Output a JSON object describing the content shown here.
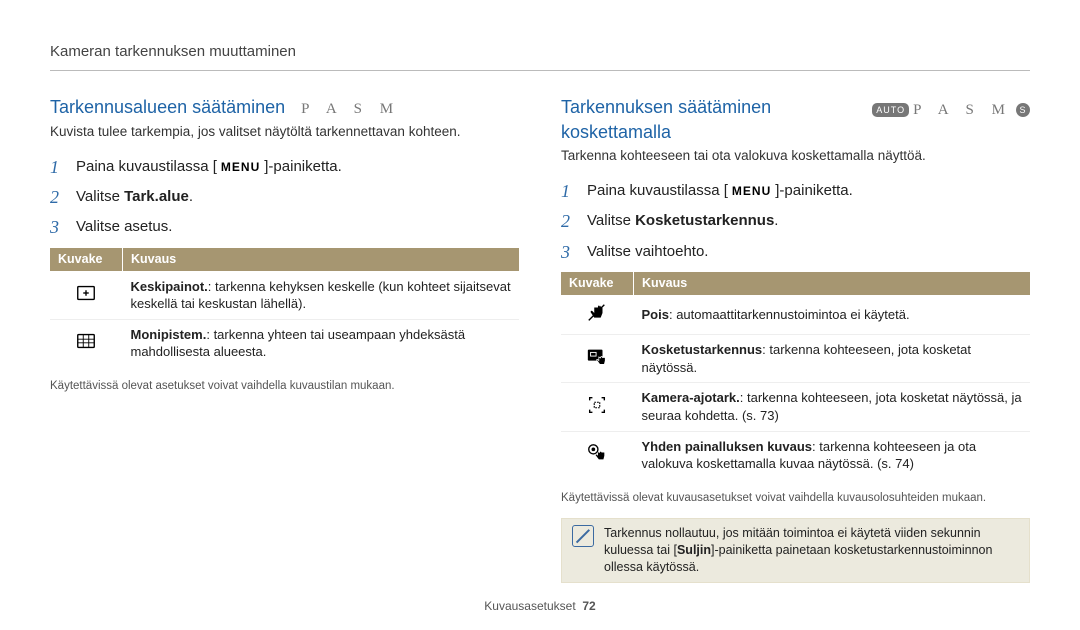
{
  "header": "Kameran tarkennuksen muuttaminen",
  "footer": {
    "label": "Kuvausasetukset",
    "page": "72"
  },
  "table_headers": [
    "Kuvake",
    "Kuvaus"
  ],
  "menu_label": "MENU",
  "left": {
    "title": "Tarkennusalueen säätäminen",
    "modes_text": "P A S M",
    "intro": "Kuvista tulee tarkempia, jos valitset näytöltä tarkennettavan kohteen.",
    "steps": [
      {
        "pre": "Paina kuvaustilassa [",
        "post": "]-painiketta."
      },
      {
        "plain_a": "Valitse ",
        "bold": "Tark.alue",
        "plain_b": "."
      },
      {
        "plain_a": "Valitse asetus.",
        "bold": "",
        "plain_b": ""
      }
    ],
    "rows": [
      {
        "icon": "center-plus",
        "term": "Keskipainot.",
        "desc": ": tarkenna kehyksen keskelle (kun kohteet sijaitsevat keskellä tai keskustan lähellä)."
      },
      {
        "icon": "grid",
        "term": "Monipistem.",
        "desc": ": tarkenna yhteen tai useampaan yhdeksästä mahdollisesta alueesta."
      }
    ],
    "footnote": "Käytettävissä olevat asetukset voivat vaihdella kuvaustilan mukaan."
  },
  "right": {
    "title": "Tarkennuksen säätäminen koskettamalla",
    "modes_text": "P A S M",
    "mode_chip_auto": "AUTO",
    "mode_chip_s": "S",
    "intro": "Tarkenna kohteeseen tai ota valokuva koskettamalla näyttöä.",
    "steps": [
      {
        "pre": "Paina kuvaustilassa [",
        "post": "]-painiketta."
      },
      {
        "plain_a": "Valitse ",
        "bold": "Kosketustarkennus",
        "plain_b": "."
      },
      {
        "plain_a": "Valitse vaihtoehto.",
        "bold": "",
        "plain_b": ""
      }
    ],
    "rows": [
      {
        "icon": "hand-off",
        "term": "Pois",
        "desc": ": automaattitarkennustoimintoa ei käytetä."
      },
      {
        "icon": "touch-focus",
        "term": "Kosketustarkennus",
        "desc": ": tarkenna kohteeseen, jota kosketat näytössä."
      },
      {
        "icon": "crosshair",
        "term": "Kamera-ajotark.",
        "desc": ": tarkenna kohteeseen, jota kosketat näytössä, ja seuraa kohdetta. (s. 73)"
      },
      {
        "icon": "shutter-hand",
        "term": "Yhden painalluksen kuvaus",
        "desc": ": tarkenna kohteeseen ja ota valokuva koskettamalla kuvaa näytössä. (s. 74)"
      }
    ],
    "footnote": "Käytettävissä olevat kuvausasetukset voivat vaihdella kuvausolosuhteiden mukaan.",
    "note": {
      "line1_pre": "Tarkennus nollautuu, jos mitään toimintoa ei käytetä viiden sekunnin kuluessa tai",
      "line2_bold": "Suljin",
      "line2_post": "-painiketta painetaan kosketustarkennustoiminnon ollessa käytössä."
    }
  }
}
